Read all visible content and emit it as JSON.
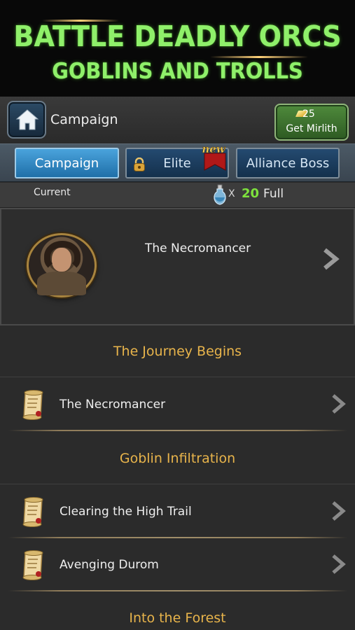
{
  "banner": {
    "line1": "BATTLE DEADLY ORCS",
    "line2": "GOBLINS AND TROLLS"
  },
  "header": {
    "title": "Campaign",
    "home_icon": "home-icon",
    "mirlith_count": "25",
    "mirlith_label": "Get Mirlith"
  },
  "tabs": [
    {
      "label": "Campaign",
      "active": true
    },
    {
      "label": "Elite",
      "badge": "new",
      "icon": "lock-icon"
    },
    {
      "label": "Alliance Boss"
    }
  ],
  "current": {
    "label": "Current",
    "potion_x": "X",
    "potion_count": "20",
    "potion_status": "Full",
    "mission": "The Necromancer"
  },
  "sections": [
    {
      "title": "The Journey Begins",
      "missions": [
        "The Necromancer"
      ]
    },
    {
      "title": "Goblin Infiltration",
      "missions": [
        "Clearing the High Trail",
        "Avenging Durom"
      ]
    },
    {
      "title": "Into the Forest",
      "missions": []
    }
  ],
  "colors": {
    "banner_text": "#8ff06a",
    "section_header": "#e8b44b",
    "potion_count": "#7ee23d",
    "active_tab": "#2f8acb"
  }
}
